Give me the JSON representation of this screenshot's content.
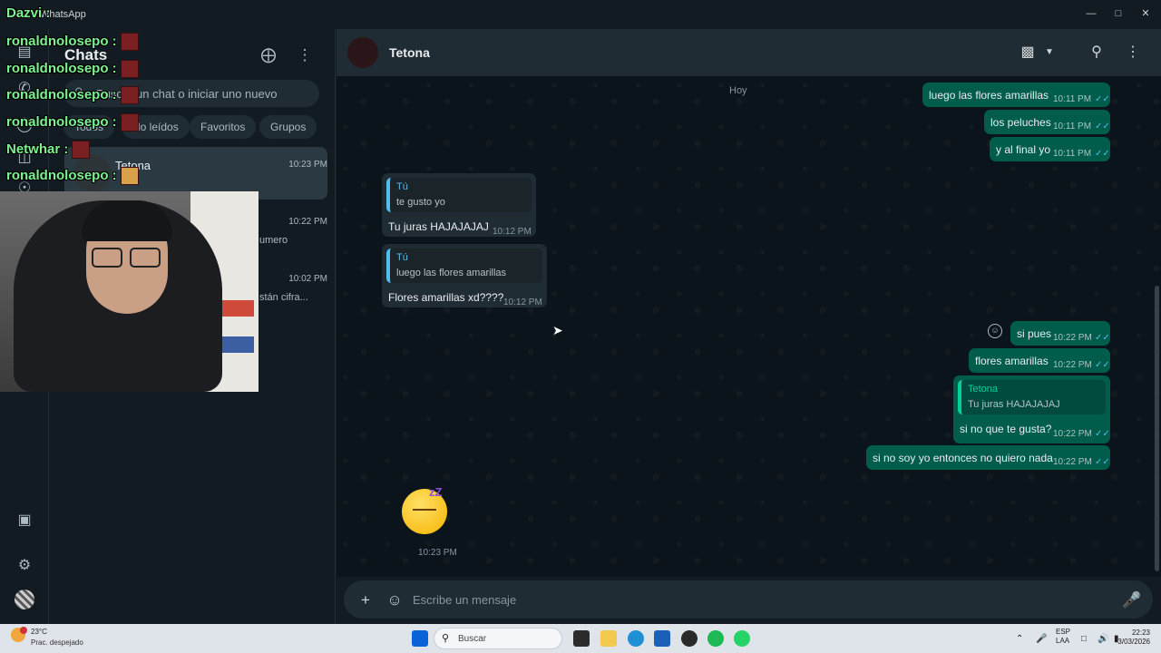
{
  "window": {
    "title": "WhatsApp"
  },
  "panel": {
    "title": "Chats",
    "search_placeholder": "Buscar un chat o iniciar uno nuevo",
    "filters": [
      "Todos",
      "No leídos",
      "Favoritos",
      "Grupos"
    ],
    "chats": [
      {
        "name": "Tetona",
        "time": "10:23 PM",
        "preview": ""
      },
      {
        "name": "",
        "time": "10:22 PM",
        "preview": "umero"
      },
      {
        "name": "",
        "time": "10:02 PM",
        "preview": "stán cifra..."
      }
    ]
  },
  "overlay": {
    "lines": [
      {
        "user": "Dazvi",
        "sep": " :"
      },
      {
        "user": "ronaldnolosepo",
        "sep": " :"
      },
      {
        "user": "ronaldnolosepo",
        "sep": " :"
      },
      {
        "user": "ronaldnolosepo",
        "sep": " :"
      },
      {
        "user": "ronaldnolosepo",
        "sep": " :"
      },
      {
        "user": "Netwhar",
        "sep": " :"
      },
      {
        "user": "ronaldnolosepo",
        "sep": " :"
      }
    ]
  },
  "chat": {
    "contact": "Tetona",
    "day": "Hoy",
    "messages_out_top": [
      {
        "text": "luego las flores amarillas",
        "time": "10:11 PM"
      },
      {
        "text": "los peluches",
        "time": "10:11 PM"
      },
      {
        "text": "y al final yo",
        "time": "10:11 PM"
      }
    ],
    "messages_in": [
      {
        "quote_name": "Tú",
        "quote_text": "te gusto yo",
        "text": "Tu juras HAJAJAJAJ",
        "time": "10:12 PM"
      },
      {
        "quote_name": "Tú",
        "quote_text": "luego las flores amarillas",
        "text": "Flores amarillas xd????",
        "time": "10:12 PM"
      }
    ],
    "messages_out_bottom": [
      {
        "text": "si pues",
        "time": "10:22 PM"
      },
      {
        "text": "flores amarillas",
        "time": "10:22 PM"
      },
      {
        "quote_name": "Tetona",
        "quote_text": "Tu juras HAJAJAJAJ",
        "text": "si no que te gusta?",
        "time": "10:22 PM"
      },
      {
        "text": "si no soy yo entonces no quiero nada",
        "time": "10:22 PM"
      }
    ],
    "sticker_time": "10:23 PM"
  },
  "composer": {
    "placeholder": "Escribe un mensaje"
  },
  "taskbar": {
    "weather_temp": "23°C",
    "weather_desc": "Prac. despejado",
    "search_label": "Buscar",
    "lang_top": "ESP",
    "lang_bottom": "LAA",
    "time": "22:23",
    "date": "3/03/2026"
  },
  "colors": {
    "accent": "#00a884",
    "outgoing": "#005c4b",
    "incoming": "#202c33",
    "overlay_name": "#7cf291"
  }
}
